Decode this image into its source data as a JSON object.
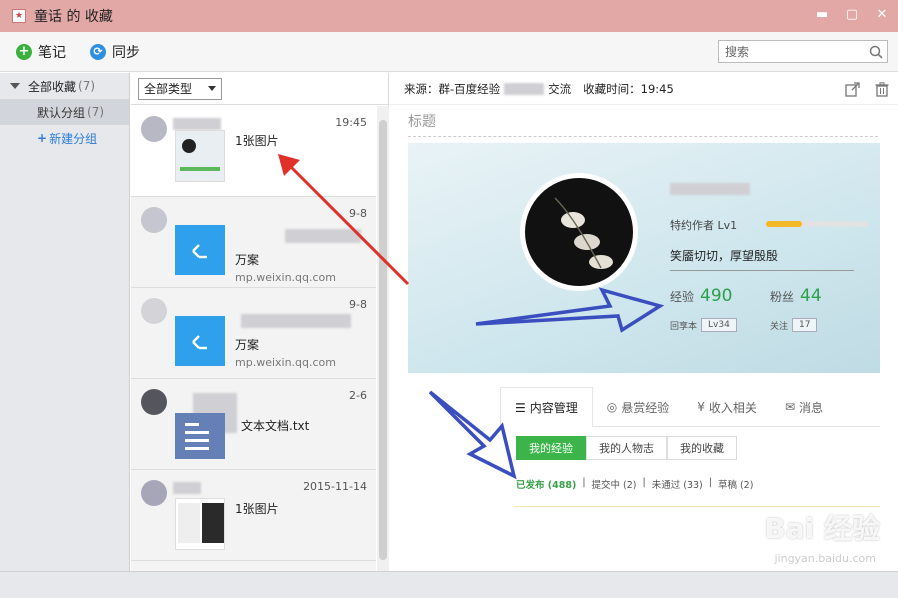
{
  "window": {
    "title": "童话 的 收藏",
    "minimize": "▬",
    "maximize": "▢",
    "close": "✕"
  },
  "toolbar": {
    "note_label": "笔记",
    "sync_label": "同步",
    "search_placeholder": "搜索"
  },
  "sidebar": {
    "all_label": "全部收藏",
    "all_count": "(7)",
    "default_group_label": "默认分组",
    "default_group_count": "(7)",
    "new_group_label": "新建分组"
  },
  "filter": {
    "selected": "全部类型"
  },
  "list": [
    {
      "time": "19:45",
      "title": "1张图片",
      "src": ""
    },
    {
      "time": "9-8",
      "title": "万案",
      "src": "mp.weixin.qq.com"
    },
    {
      "time": "9-8",
      "title": "万案",
      "src": "mp.weixin.qq.com"
    },
    {
      "time": "2-6",
      "title": "文本文档.txt",
      "src": ""
    },
    {
      "time": "2015-11-14",
      "title": "1张图片",
      "src": ""
    }
  ],
  "content": {
    "source_label": "来源：群-百度经验",
    "source_tail": "交流",
    "time_label": "收藏时间：19:45",
    "title_placeholder": "标题",
    "embed": {
      "author_tag": "特约作者 Lv1",
      "motto": "笑靥切切，厚望殷殷",
      "exp_label": "经验",
      "exp_value": "490",
      "fans_label": "粉丝",
      "fans_value": "44",
      "level_label": "回享本",
      "level_value": "Lv34",
      "follow_label": "关注",
      "follow_value": "17",
      "tabs": [
        "内容管理",
        "悬赏经验",
        "收入相关",
        "消息"
      ],
      "subtabs": [
        "我的经验",
        "我的人物志",
        "我的收藏"
      ],
      "status": [
        "已发布 (488)",
        "提交中 (2)",
        "未通过 (33)",
        "草稿 (2)"
      ],
      "watermark": "Bai 经验",
      "watermark_sub": "jingyan.baidu.com"
    }
  }
}
